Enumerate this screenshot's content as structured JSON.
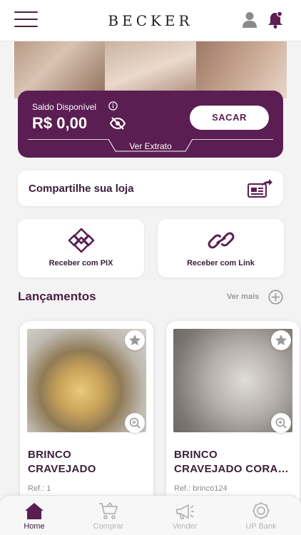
{
  "header": {
    "logo": "BECKER",
    "menu_icon": "hamburger-menu-icon",
    "user_icon": "user-icon",
    "notification_icon": "bell-icon"
  },
  "balance": {
    "label": "Saldo Disponível",
    "value": "R$ 0,00",
    "withdraw_label": "SACAR",
    "statement_label": "Ver Extrato"
  },
  "share": {
    "label": "Compartilhe sua loja",
    "icon": "share-store-icon"
  },
  "actions": {
    "pix_label": "Receber com PIX",
    "link_label": "Receber com Link"
  },
  "releases": {
    "title": "Lançamentos",
    "see_more": "Ver mais",
    "products": [
      {
        "name_line1": "BRINCO",
        "name_line2": "CRAVEJADO",
        "ref": "Ref.: 1"
      },
      {
        "name_line1": "BRINCO",
        "name_line2": "CRAVEJADO CORAÇÃO",
        "ref": "Ref.: brinco124"
      }
    ]
  },
  "nav": {
    "items": [
      {
        "label": "Home",
        "icon": "home-icon",
        "active": true
      },
      {
        "label": "Comprar",
        "icon": "cart-icon",
        "active": false
      },
      {
        "label": "Vender",
        "icon": "megaphone-icon",
        "active": false
      },
      {
        "label": "UP Bank",
        "icon": "bank-icon",
        "active": false
      }
    ]
  },
  "colors": {
    "brand": "#5a1e52",
    "text": "#3a1f3a",
    "muted": "#b5b5b5",
    "background": "#f4f3f4"
  }
}
